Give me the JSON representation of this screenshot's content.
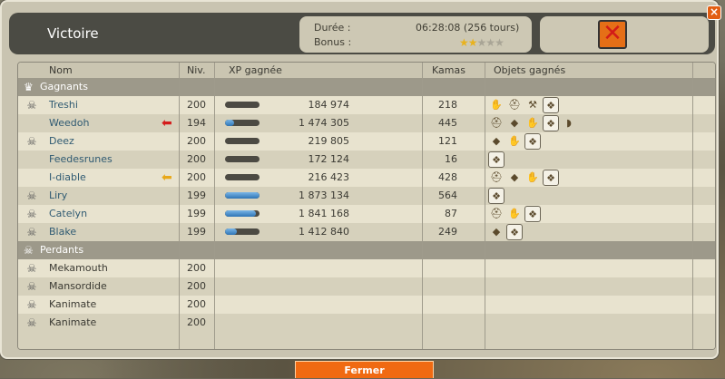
{
  "window": {
    "title": "Victoire",
    "close_glyph": "×"
  },
  "info": {
    "duration_label": "Durée :",
    "duration_value": "06:28:08 (256 tours)",
    "bonus_label": "Bonus :",
    "bonus_stars_filled": 2,
    "bonus_stars_total": 5
  },
  "columns": {
    "name": "Nom",
    "level": "Niv.",
    "xp": "XP gagnée",
    "kamas": "Kamas",
    "items": "Objets gagnés"
  },
  "groups": {
    "winners": "Gagnants",
    "losers": "Perdants"
  },
  "winners": [
    {
      "name": "Treshi",
      "skull": true,
      "level": "200",
      "xp_fill": 0,
      "xp": "184 974",
      "kamas": "218",
      "items": [
        "claw-icon",
        "helmet-icon",
        "pickaxe-icon",
        "resource-icon"
      ],
      "arrow": ""
    },
    {
      "name": "Weedoh",
      "skull": false,
      "level": "194",
      "xp_fill": 0.25,
      "xp": "1 474 305",
      "kamas": "445",
      "items": [
        "helmet-icon",
        "stone-icon",
        "claw-icon",
        "resource-icon",
        "bread-icon"
      ],
      "arrow": "red"
    },
    {
      "name": "Deez",
      "skull": true,
      "level": "200",
      "xp_fill": 0,
      "xp": "219 805",
      "kamas": "121",
      "items": [
        "stone-icon",
        "claw-icon",
        "resource-icon"
      ],
      "arrow": ""
    },
    {
      "name": "Feedesrunes",
      "skull": false,
      "level": "200",
      "xp_fill": 0,
      "xp": "172 124",
      "kamas": "16",
      "items": [
        "resource-icon"
      ],
      "arrow": ""
    },
    {
      "name": "I-diable",
      "skull": false,
      "level": "200",
      "xp_fill": 0,
      "xp": "216 423",
      "kamas": "428",
      "items": [
        "helmet-icon",
        "stone-icon",
        "claw-icon",
        "resource-icon"
      ],
      "arrow": "yellow"
    },
    {
      "name": "Liry",
      "skull": true,
      "level": "199",
      "xp_fill": 1.0,
      "xp": "1 873 134",
      "kamas": "564",
      "items": [
        "resource-icon"
      ],
      "arrow": ""
    },
    {
      "name": "Catelyn",
      "skull": true,
      "level": "199",
      "xp_fill": 0.9,
      "xp": "1 841 168",
      "kamas": "87",
      "items": [
        "helmet-icon",
        "claw-icon",
        "resource-icon"
      ],
      "arrow": ""
    },
    {
      "name": "Blake",
      "skull": true,
      "level": "199",
      "xp_fill": 0.35,
      "xp": "1 412 840",
      "kamas": "249",
      "items": [
        "stone-icon",
        "resource-icon"
      ],
      "arrow": ""
    }
  ],
  "losers": [
    {
      "name": "Mekamouth",
      "level": "200"
    },
    {
      "name": "Mansordide",
      "level": "200"
    },
    {
      "name": "Kanimate",
      "level": "200"
    },
    {
      "name": "Kanimate",
      "level": "200"
    }
  ],
  "close_button": "Fermer",
  "colors": {
    "accent": "#f06a12",
    "header": "#4b4b44",
    "name_link": "#2f5a72",
    "xp_bar": "#2d74b6"
  }
}
